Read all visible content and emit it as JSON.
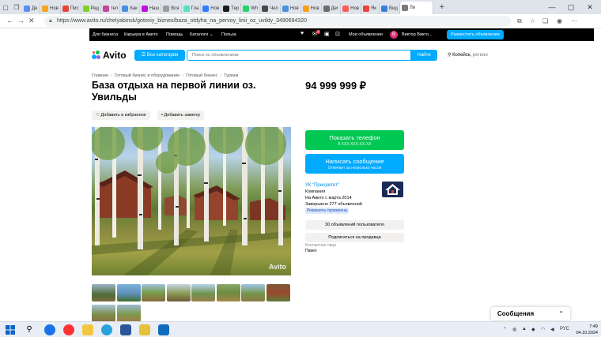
{
  "browser": {
    "tabs": [
      "Де",
      "Нов",
      "Пис",
      "Ред",
      "тел",
      "Как",
      "Наш",
      "Вся",
      "Гла",
      "Нов",
      "Тер",
      "Wh",
      "Чел",
      "Нов",
      "Нов",
      "Дег",
      "Нов",
      "Як",
      "Вид",
      "Ли"
    ],
    "url": "https://www.avito.ru/chelyabinsk/gotoviy_biznes/baza_otdyha_na_pervoy_linii_oz_uvildy_3490694320"
  },
  "topbar": {
    "links": [
      "Для бизнеса",
      "Карьера в Авито",
      "Помощь",
      "Каталоги",
      "Польза"
    ],
    "catalogs_chevron": "⌄",
    "my_ads": "Мои объявления",
    "user_initial": "В",
    "user_name": "Виктор Викто...",
    "post_ad": "Разместить объявление",
    "notif_badge": "1"
  },
  "header": {
    "logo": "Avito",
    "all_categories": "Все категории",
    "search_placeholder": "Поиск по объявлениям",
    "search_button": "Найти",
    "city": "Копейск,",
    "region": "регион"
  },
  "breadcrumbs": [
    "Главная",
    "Готовый бизнес и оборудование",
    "Готовый бизнес",
    "Туризм"
  ],
  "listing": {
    "title": "База отдыха на первой линии оз. Увильды",
    "price": "94 999 999 ₽",
    "add_favorite": "Добавить в избранное",
    "add_note": "Добавить заметку",
    "photo_watermark": "Avito",
    "thumbnail_count": 10
  },
  "actions": {
    "show_phone": "Показать телефон",
    "phone_masked": "8 XXX XXX-XX-XX",
    "write_message": "Написать сообщение",
    "reply_time": "Отвечает за несколько часов"
  },
  "seller": {
    "name": "УК \"Приоритет\"",
    "type": "Компания",
    "since": "На Авито с марта 2014",
    "completed": "Завершено 277 объявлений",
    "badge": "Реквизиты проверены",
    "ads_button": "30 объявлений пользователя",
    "subscribe_button": "Подписаться на продавца",
    "contact_label": "Контактное лицо",
    "contact_name": "Павел"
  },
  "messages_widget": {
    "label": "Сообщения",
    "chevron": "⌃"
  },
  "taskbar": {
    "time": "7:49",
    "date": "04.10.2024",
    "lang": "РУС"
  },
  "colors": {
    "avito_blue": "#00aaff",
    "phone_green": "#00c853",
    "topbar_black": "#000000"
  }
}
